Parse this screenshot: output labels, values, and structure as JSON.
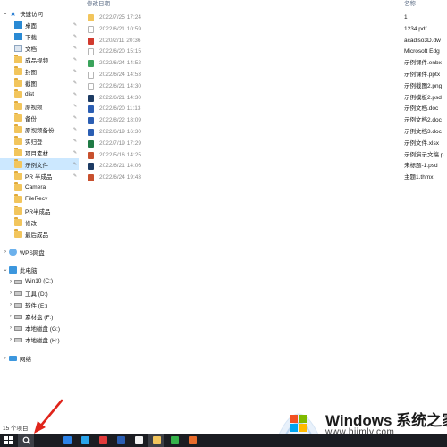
{
  "nav": {
    "items": [
      {
        "label": "快速访问",
        "icon": "star-icon",
        "chevron": "⌄",
        "pinned": false
      },
      {
        "label": "桌面",
        "icon": "desktop-icon",
        "pinned": true
      },
      {
        "label": "下载",
        "icon": "download-icon",
        "pinned": true
      },
      {
        "label": "文档",
        "icon": "documents-icon",
        "pinned": true
      },
      {
        "label": "成品视频",
        "icon": "folder-icon",
        "pinned": true
      },
      {
        "label": "封图",
        "icon": "folder-icon",
        "pinned": true
      },
      {
        "label": "截图",
        "icon": "folder-icon",
        "pinned": true
      },
      {
        "label": "dist",
        "icon": "folder-icon",
        "pinned": true
      },
      {
        "label": "原视频",
        "icon": "folder-icon",
        "pinned": true
      },
      {
        "label": "备份",
        "icon": "folder-icon",
        "pinned": true
      },
      {
        "label": "原视频备份",
        "icon": "folder-icon",
        "pinned": true
      },
      {
        "label": "实归登",
        "icon": "folder-icon",
        "pinned": true
      },
      {
        "label": "项目素材",
        "icon": "folder-icon",
        "pinned": true
      },
      {
        "label": "示例文件",
        "icon": "folder-icon",
        "pinned": true,
        "selected": true
      },
      {
        "label": "PR 半成品",
        "icon": "folder-icon",
        "pinned": true
      },
      {
        "label": "Camera",
        "icon": "folder-icon",
        "pinned": false
      },
      {
        "label": "FileRecv",
        "icon": "folder-icon",
        "pinned": false
      },
      {
        "label": "PR半成品",
        "icon": "folder-icon",
        "pinned": false
      },
      {
        "label": "修改",
        "icon": "folder-icon",
        "pinned": false
      },
      {
        "label": "最后成品",
        "icon": "folder-icon",
        "pinned": false
      },
      {
        "label": "WPS网盘",
        "icon": "cloud-icon",
        "chevron": "›",
        "pinned": false
      },
      {
        "label": "此电脑",
        "icon": "computer-icon",
        "chevron": "⌄",
        "pinned": false
      },
      {
        "label": "Win10 (C:)",
        "icon": "drive-icon",
        "chevron": "›",
        "pinned": false
      },
      {
        "label": "工具 (D:)",
        "icon": "drive-icon",
        "chevron": "›",
        "pinned": false
      },
      {
        "label": "软件 (E:)",
        "icon": "drive-icon",
        "chevron": "›",
        "pinned": false
      },
      {
        "label": "素材盘 (F:)",
        "icon": "drive-icon",
        "chevron": "›",
        "pinned": false
      },
      {
        "label": "本地磁盘 (G:)",
        "icon": "drive-icon",
        "chevron": "›",
        "pinned": false
      },
      {
        "label": "本地磁盘 (H:)",
        "icon": "drive-icon",
        "chevron": "›",
        "pinned": false
      },
      {
        "label": "网络",
        "icon": "network-icon",
        "chevron": "›",
        "pinned": false
      }
    ],
    "pin_glyph": "✎"
  },
  "content": {
    "headers": {
      "date": "修改日期",
      "name": "名称"
    },
    "files": [
      {
        "date": "2022/7/25 17:24",
        "name": "1",
        "icon": "folder-icon",
        "color": "#f2c55c"
      },
      {
        "date": "2022/6/21 10:59",
        "name": "1234.pdf",
        "icon": "pdf-icon",
        "color": "#ffffff"
      },
      {
        "date": "2020/2/11 20:36",
        "name": "acadiso3D.dw",
        "icon": "dwg-icon",
        "color": "#d13a2e"
      },
      {
        "date": "2022/6/20 15:15",
        "name": "Microsoft Edg",
        "icon": "blank-file-icon",
        "color": "#ffffff"
      },
      {
        "date": "2022/6/24 14:52",
        "name": "示例课件.enbx",
        "icon": "enbx-icon",
        "color": "#3aa35b"
      },
      {
        "date": "2022/6/24 14:53",
        "name": "示例课件.pptx",
        "icon": "blank-file-icon",
        "color": "#ffffff"
      },
      {
        "date": "2022/6/21 14:30",
        "name": "示例截图2.png",
        "icon": "blank-file-icon",
        "color": "#ffffff"
      },
      {
        "date": "2022/6/21 14:30",
        "name": "示例模板2.psd",
        "icon": "psd-icon",
        "color": "#1d3b63"
      },
      {
        "date": "2022/6/20 11:13",
        "name": "示例文档.doc",
        "icon": "word-icon",
        "color": "#2b5eb3"
      },
      {
        "date": "2022/8/22 18:09",
        "name": "示例文档2.doc",
        "icon": "word-icon",
        "color": "#2b5eb3"
      },
      {
        "date": "2022/6/19 16:30",
        "name": "示例文档3.doc",
        "icon": "word-icon",
        "color": "#2b5eb3"
      },
      {
        "date": "2022/7/19 17:29",
        "name": "示例文件.xlsx",
        "icon": "excel-icon",
        "color": "#1f7a45"
      },
      {
        "date": "2022/5/16 14:25",
        "name": "示例演示文稿.p",
        "icon": "ppt-icon",
        "color": "#c8502e"
      },
      {
        "date": "2022/6/21 14:06",
        "name": "未标题-1.psd",
        "icon": "psd-icon",
        "color": "#1d3b63"
      },
      {
        "date": "2022/6/24 19:43",
        "name": "主题1.thmx",
        "icon": "theme-icon",
        "color": "#c8502e"
      }
    ]
  },
  "status": {
    "item_count": "15 个项目"
  },
  "watermark": {
    "title": "Windows 系统之家",
    "url": "www.bjjmlv.com"
  },
  "taskbar": {
    "items": [
      {
        "name": "start-icon",
        "color": "#ffffff"
      },
      {
        "name": "search-icon",
        "color": "#ffffff",
        "active": true
      },
      {
        "name": "task-view-icon",
        "color": "#1b1d22"
      },
      {
        "name": "app-blue-icon",
        "color": "#2c83e8"
      },
      {
        "name": "app-tencent-icon",
        "color": "#2aa4ea"
      },
      {
        "name": "app-red-icon",
        "color": "#e23b3b"
      },
      {
        "name": "app-word-icon",
        "color": "#2b5eb3"
      },
      {
        "name": "app-file-icon",
        "color": "#f2f2f2"
      },
      {
        "name": "file-explorer-icon",
        "color": "#f2c55c",
        "active": true
      },
      {
        "name": "app-green-icon",
        "color": "#35b24a"
      },
      {
        "name": "app-orange-icon",
        "color": "#e96c2b"
      }
    ]
  },
  "colors": {
    "selection": "#cce8ff",
    "arrow": "#e0241b",
    "taskbar": "#1b1d22"
  }
}
